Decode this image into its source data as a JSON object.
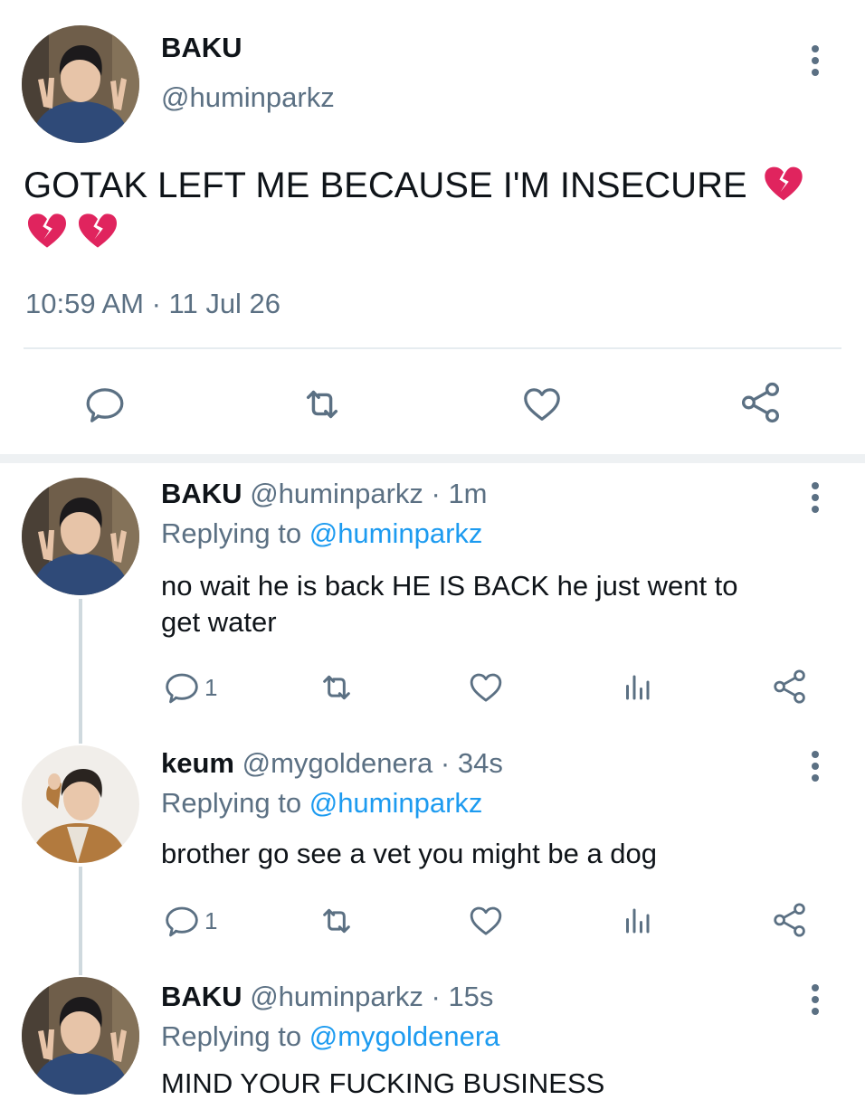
{
  "main_tweet": {
    "name": "BAKU",
    "handle": "@huminparkz",
    "text": "GOTAK LEFT ME BECAUSE I'M INSECURE",
    "timestamp": "10:59 AM · 11 Jul 26"
  },
  "replies": [
    {
      "name": "BAKU",
      "handle_time": "@huminparkz · 1m",
      "replying_prefix": "Replying to ",
      "replying_to": "@huminparkz",
      "text_line1": "no wait he is back HE IS BACK he just went to",
      "text_line2": "get water",
      "reply_count": "1"
    },
    {
      "name": "keum",
      "handle_time": "@mygoldenera · 34s",
      "replying_prefix": "Replying to ",
      "replying_to": "@huminparkz",
      "text_line1": "brother go see a vet you might be a dog",
      "reply_count": "1"
    },
    {
      "name": "BAKU",
      "handle_time": "@huminparkz · 15s",
      "replying_prefix": "Replying to ",
      "replying_to": "@mygoldenera",
      "text_line1": "MIND YOUR FUCKING BUSINESS"
    }
  ],
  "icons": [
    "more-icon",
    "reply-icon",
    "retweet-icon",
    "like-icon",
    "share-icon",
    "analytics-icon",
    "broken-heart-emoji"
  ],
  "colors": {
    "accent": "#1d9bf0",
    "secondary_text": "#5b7083",
    "emoji": "#e0245e"
  }
}
